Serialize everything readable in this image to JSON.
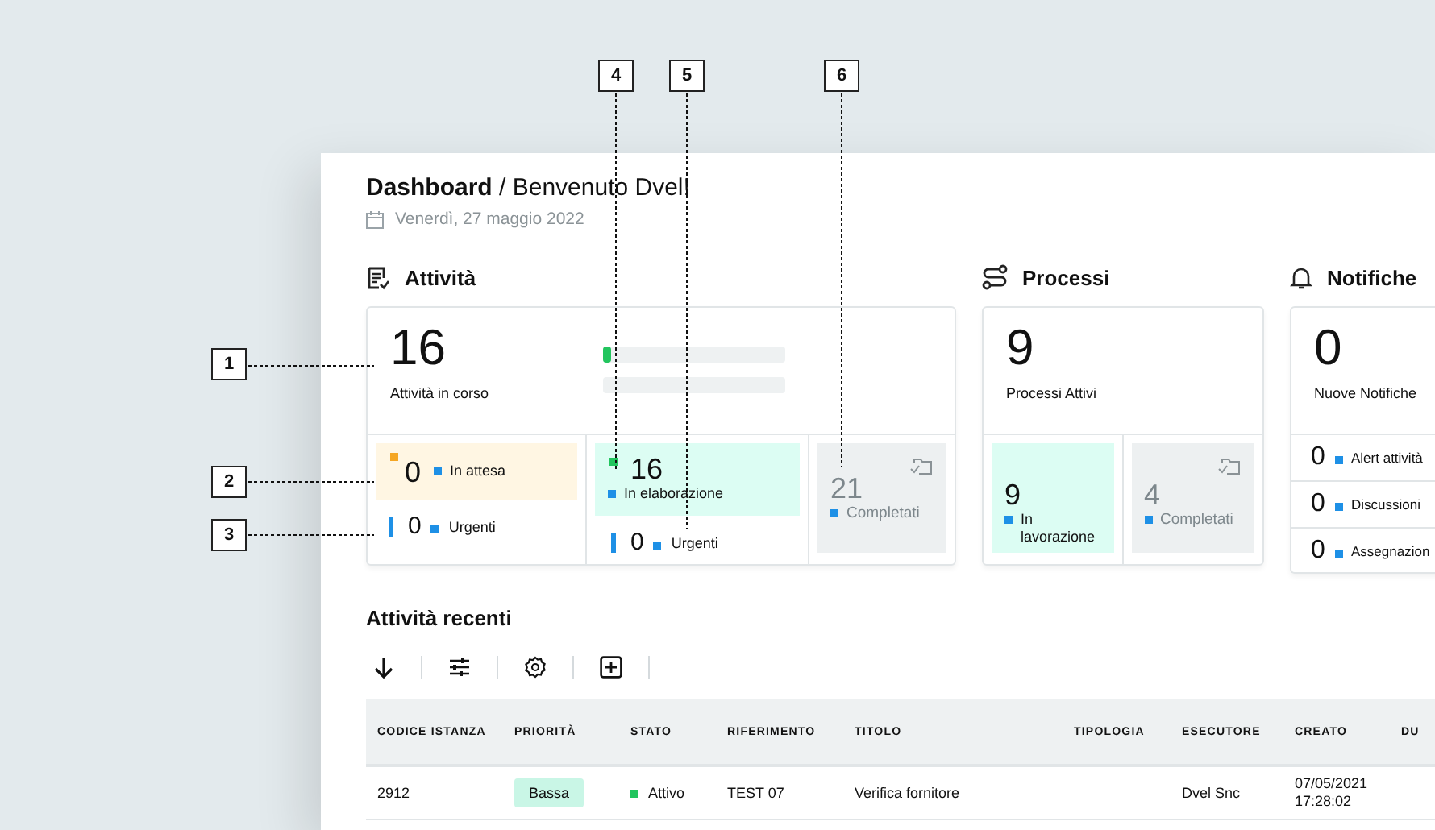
{
  "header": {
    "title": "**Dashboard** / Benvenuto Dvel!",
    "date": "Venerdì, 27 maggio 2022"
  },
  "activity": {
    "title": "Attività",
    "count": "16",
    "label": "Attività in corso",
    "bar": {
      "level": 0.04
    },
    "columns": [
      {
        "tile": {
          "kind": "pending",
          "value": "0",
          "label": "In attesa",
          "color": "#f5a623"
        },
        "urgent": {
          "value": "0",
          "label": "Urgenti"
        }
      },
      {
        "tile": {
          "kind": "processing",
          "value": "16",
          "label": "In elaborazione",
          "color": "#22c55e"
        },
        "urgent": {
          "value": "0",
          "label": "Urgenti"
        }
      },
      {
        "tile": {
          "kind": "completed",
          "value": "21",
          "label": "Completati"
        }
      }
    ]
  },
  "processes": {
    "title": "Processi",
    "count": "9",
    "label": "Processi Attivi",
    "tiles": [
      {
        "kind": "processing",
        "value": "9",
        "label": "In lavorazione"
      },
      {
        "kind": "completed",
        "value": "4",
        "label": "Completati"
      }
    ]
  },
  "notifications": {
    "title": "Notifiche",
    "count": "0",
    "label": "Nuove Notifiche",
    "rows": [
      {
        "value": "0",
        "label": "Alert attività"
      },
      {
        "value": "0",
        "label": "Discussioni"
      },
      {
        "value": "0",
        "label": "Assegnazion"
      }
    ]
  },
  "recent": {
    "title": "Attività recenti",
    "columns": [
      "CODICE ISTANZA",
      "PRIORITÀ",
      "STATO",
      "RIFERIMENTO",
      "TITOLO",
      "TIPOLOGIA",
      "ESECUTORE",
      "CREATO",
      "DU"
    ],
    "rows": [
      {
        "code": "2912",
        "priority": "Bassa",
        "status": "Attivo",
        "color": "#22c55e",
        "reference": "TEST 07",
        "title": "Verifica fornitore",
        "executor": "Dvel Snc",
        "created": "07/05/2021 17:28:02"
      }
    ]
  },
  "callouts": [
    {
      "label": "1"
    },
    {
      "label": "2"
    },
    {
      "label": "3"
    },
    {
      "label": "4"
    },
    {
      "label": "5"
    },
    {
      "label": "6"
    }
  ]
}
